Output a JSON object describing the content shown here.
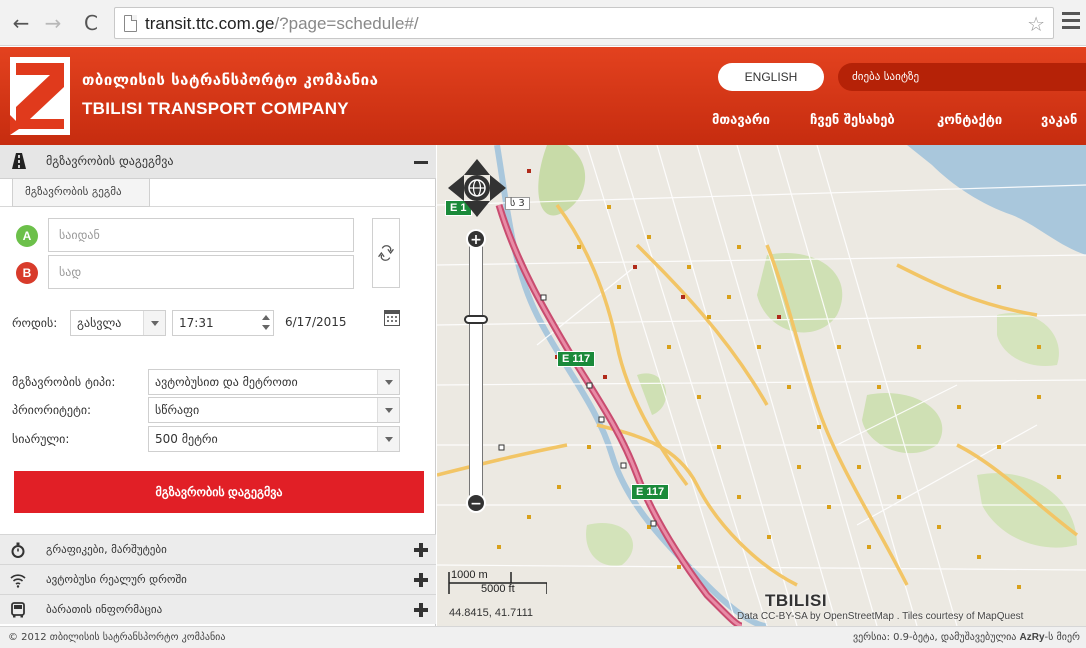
{
  "browser": {
    "url_host": "transit.ttc.com.ge",
    "url_path": "/?page=schedule#/"
  },
  "header": {
    "brand_geo": "თბილისის სატრანსპორტო კომპანია",
    "brand_en": "TBILISI TRANSPORT COMPANY",
    "lang_button": "ENGLISH",
    "search_placeholder": "ძიება საიტზე",
    "nav": [
      "მთავარი",
      "ჩვენ შესახებ",
      "კონტაქტი",
      "ვაკან"
    ]
  },
  "planner": {
    "title": "მგზავრობის დაგეგმვა",
    "tab": "მგზავრობის გეგმა",
    "from_placeholder": "საიდან",
    "to_placeholder": "სად",
    "pin_a": "A",
    "pin_b": "B",
    "when_label": "როდის:",
    "when_value": "გასვლა",
    "time_value": "17:31",
    "date_value": "6/17/2015",
    "trip_type_label": "მგზავრობის ტიპი:",
    "trip_type_value": "ავტობუსით და მეტროთი",
    "priority_label": "პრიორიტეტი:",
    "priority_value": "სწრაფი",
    "walk_label": "სიარული:",
    "walk_value": "500 მეტრი",
    "plan_button": "მგზავრობის დაგეგმვა"
  },
  "accordion": [
    {
      "label": "გრაფიკები, მარშუტები",
      "icon": "stopwatch-icon"
    },
    {
      "label": "ავტობუსი რეალურ დროში",
      "icon": "wifi-icon"
    },
    {
      "label": "ბარათის ინფორმაცია",
      "icon": "bus-icon"
    }
  ],
  "map": {
    "road_shield_1": "E 117",
    "road_shield_2": "E 117",
    "road_shield_top": "E 1",
    "route_label": "ს 3",
    "zoom_plus": "+",
    "zoom_minus": "−",
    "scale_m": "1000 m",
    "scale_ft": "5000 ft",
    "coords": "44.8415, 41.7111",
    "city": "TBILISI",
    "attribution": "Data CC-BY-SA by OpenStreetMap . Tiles courtesy of MapQuest",
    "colors": {
      "land": "#ece9e2",
      "water": "#a9c7dc",
      "park": "#c8dba8",
      "highway": "#d9567a",
      "road": "#f2c566"
    }
  },
  "footer": {
    "copyright": "© 2012 თბილისის სატრანსპორტო კომპანია",
    "version_prefix": "ვერსია: 0.9-ბეტა, დამუშავებულია ",
    "version_brand": "AzRy",
    "version_suffix": "-ს მიერ"
  }
}
